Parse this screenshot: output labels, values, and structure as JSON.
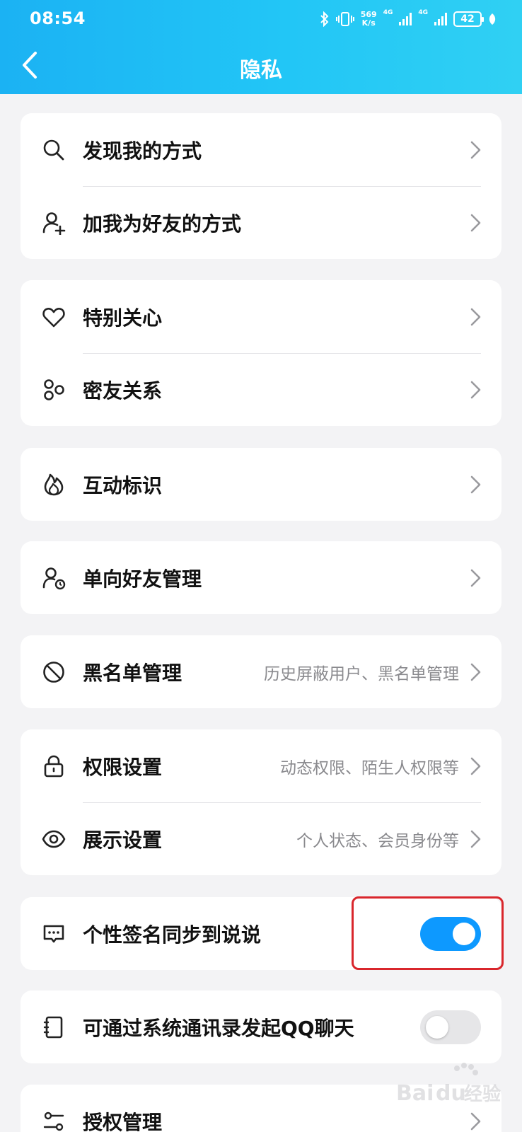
{
  "status_bar": {
    "time": "08:54",
    "net_speed_value": "569",
    "net_speed_unit": "K/s",
    "sim1_label": "4G",
    "sim2_label": "4G",
    "battery": "42"
  },
  "header": {
    "title": "隐私"
  },
  "sections": [
    {
      "items": [
        {
          "label": "发现我的方式",
          "icon": "search-icon"
        },
        {
          "label": "加我为好友的方式",
          "icon": "add-friend-icon"
        }
      ]
    },
    {
      "items": [
        {
          "label": "特别关心",
          "icon": "heart-icon"
        },
        {
          "label": "密友关系",
          "icon": "close-friends-icon"
        }
      ]
    },
    {
      "items": [
        {
          "label": "互动标识",
          "icon": "flame-icon"
        }
      ]
    },
    {
      "items": [
        {
          "label": "单向好友管理",
          "icon": "one-way-friend-icon"
        }
      ]
    },
    {
      "items": [
        {
          "label": "黑名单管理",
          "subtitle": "历史屏蔽用户、黑名单管理",
          "icon": "block-icon"
        }
      ]
    },
    {
      "items": [
        {
          "label": "权限设置",
          "subtitle": "动态权限、陌生人权限等",
          "icon": "lock-icon"
        },
        {
          "label": "展示设置",
          "subtitle": "个人状态、会员身份等",
          "icon": "eye-icon"
        }
      ]
    },
    {
      "items": [
        {
          "label": "个性签名同步到说说",
          "icon": "message-icon",
          "toggle": true,
          "toggle_state": "on"
        }
      ]
    },
    {
      "items": [
        {
          "label": "可通过系统通讯录发起QQ聊天",
          "icon": "contacts-book-icon",
          "toggle": true,
          "toggle_state": "off"
        }
      ]
    },
    {
      "items": [
        {
          "label": "授权管理",
          "icon": "authorization-icon"
        }
      ]
    }
  ],
  "watermark": {
    "brand": "Bai",
    "brand_suffix": "du",
    "product": "经验"
  },
  "colors": {
    "header_gradient_start": "#1bb2f3",
    "header_gradient_end": "#30d0f3",
    "toggle_on": "#0d99ff",
    "highlight_border": "#d9262c",
    "page_background": "#f3f3f5"
  }
}
